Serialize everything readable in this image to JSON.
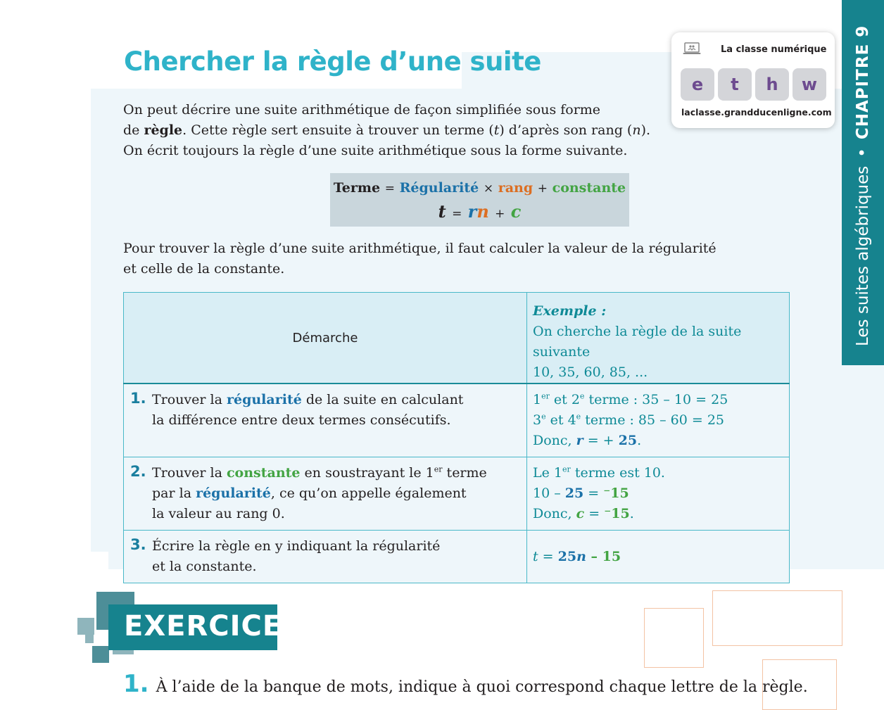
{
  "title": "Chercher la règle d’une suite",
  "intro": {
    "l1": "On peut décrire une suite arithmétique de façon simplifiée sous forme",
    "l2a": "de ",
    "l2b": "règle",
    "l2c": ". Cette règle sert ensuite à trouver un terme (",
    "l2t": "t",
    "l2d": ") d’après son rang (",
    "l2n": "n",
    "l2e": ").",
    "l3": "On écrit toujours la règle d’une suite arithmétique sous la forme suivante."
  },
  "formula": {
    "terme": "Terme",
    "eq": "=",
    "regularite": "Régularité",
    "times": "×",
    "rang": "rang",
    "plus": "+",
    "constante": "constante",
    "t": "t",
    "r": "r",
    "n": "n",
    "c": "c"
  },
  "para2": {
    "l1": "Pour trouver la règle d’une suite arithmétique, il faut calculer la valeur de la régularité",
    "l2": "et celle de la constante."
  },
  "table": {
    "head_left": "Démarche",
    "head_ex_title": "Exemple :",
    "head_ex_l1": "On cherche la règle de la suite suivante",
    "head_ex_l2": "10, 35, 60, 85, ...",
    "rows": [
      {
        "num": "1.",
        "a": "Trouver la ",
        "kw": "régularité",
        "b": " de la suite en calculant",
        "c": "la différence entre deux termes consécutifs.",
        "ex1a": "1",
        "ex1sup": "er",
        "ex1b": " et 2",
        "ex1sup2": "e",
        "ex1c": " terme : 35 – 10 = 25",
        "ex2a": "3",
        "ex2sup": "e",
        "ex2b": " et 4",
        "ex2sup2": "e",
        "ex2c": " terme : 85 – 60 = 25",
        "ex3a": "Donc, ",
        "ex3var": "r",
        "ex3b": " = + ",
        "ex3val": "25",
        "ex3c": "."
      },
      {
        "num": "2.",
        "a": "Trouver la ",
        "kw": "constante",
        "b": " en soustrayant le 1",
        "bsup": "er",
        "b2": " terme",
        "c1": "par la ",
        "ckw": "régularité",
        "c2": ", ce qu’on appelle également",
        "d": "la valeur au rang 0.",
        "ex1a": "Le 1",
        "ex1sup": "er",
        "ex1b": " terme est 10.",
        "ex2a": "10 – ",
        "ex2val": "25",
        "ex2b": " = ",
        "ex2res": "⁻15",
        "ex3a": "Donc, ",
        "ex3var": "c",
        "ex3b": " = ",
        "ex3val": "⁻15",
        "ex3c": "."
      },
      {
        "num": "3.",
        "a": "Écrire la règle en y indiquant la régularité",
        "b": "et la constante.",
        "ex_t": "t",
        "ex_eq": " = ",
        "ex_25": "25",
        "ex_n": "n",
        "ex_minus": " – 15"
      }
    ]
  },
  "classe_numerique": {
    "label": "La classe numérique",
    "letters": [
      "e",
      "t",
      "h",
      "w"
    ],
    "url": "laclasse.grandducenligne.com"
  },
  "side_tab": {
    "subject": "Les suites algébriques",
    "dot": "•",
    "chapter": "CHAPITRE 9"
  },
  "exercices": {
    "banner": "EXERCICES",
    "q1_num": "1.",
    "q1_text": "À l’aide de la banque de mots, indique à quoi correspond chaque lettre de la règle."
  },
  "colors": {
    "accent_teal": "#16838e",
    "title_cyan": "#2fb3c9",
    "regularite_blue": "#1b71a8",
    "rang_orange": "#dc6e22",
    "constante_green": "#43a443",
    "panel_bg": "#eef6fa"
  }
}
